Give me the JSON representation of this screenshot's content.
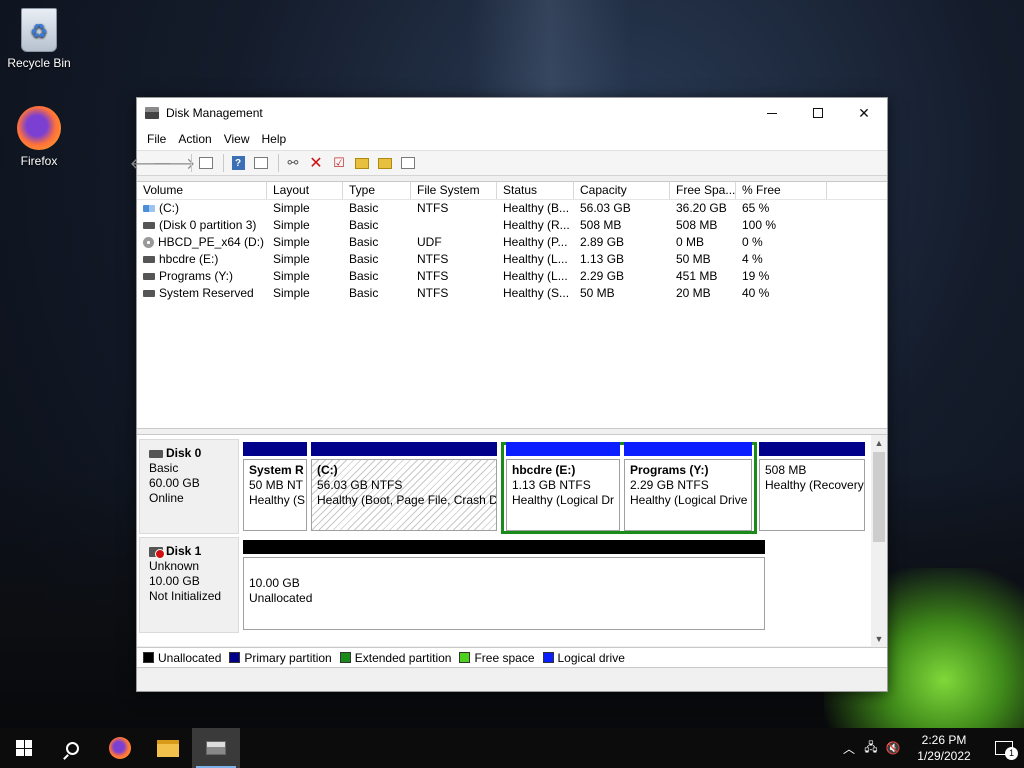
{
  "desktop": {
    "icons": [
      {
        "label": "Recycle Bin",
        "icon": "recycle-bin-icon"
      },
      {
        "label": "Firefox",
        "icon": "firefox-icon"
      }
    ]
  },
  "window": {
    "title": "Disk Management",
    "menu": [
      "File",
      "Action",
      "View",
      "Help"
    ]
  },
  "volume_list": {
    "columns": [
      "Volume",
      "Layout",
      "Type",
      "File System",
      "Status",
      "Capacity",
      "Free Spa...",
      "% Free"
    ],
    "rows": [
      {
        "volume": "(C:)",
        "layout": "Simple",
        "type": "Basic",
        "fs": "NTFS",
        "status": "Healthy (B...",
        "capacity": "56.03 GB",
        "free": "36.20 GB",
        "pct": "65 %",
        "icon": "volume-icon"
      },
      {
        "volume": "(Disk 0 partition 3)",
        "layout": "Simple",
        "type": "Basic",
        "fs": "",
        "status": "Healthy (R...",
        "capacity": "508 MB",
        "free": "508 MB",
        "pct": "100 %",
        "icon": "volume-icon"
      },
      {
        "volume": "HBCD_PE_x64 (D:)",
        "layout": "Simple",
        "type": "Basic",
        "fs": "UDF",
        "status": "Healthy (P...",
        "capacity": "2.89 GB",
        "free": "0 MB",
        "pct": "0 %",
        "icon": "cd-drive-icon"
      },
      {
        "volume": "hbcdre (E:)",
        "layout": "Simple",
        "type": "Basic",
        "fs": "NTFS",
        "status": "Healthy (L...",
        "capacity": "1.13 GB",
        "free": "50 MB",
        "pct": "4 %",
        "icon": "volume-icon"
      },
      {
        "volume": "Programs (Y:)",
        "layout": "Simple",
        "type": "Basic",
        "fs": "NTFS",
        "status": "Healthy (L...",
        "capacity": "2.29 GB",
        "free": "451 MB",
        "pct": "19 %",
        "icon": "volume-icon"
      },
      {
        "volume": "System Reserved",
        "layout": "Simple",
        "type": "Basic",
        "fs": "NTFS",
        "status": "Healthy (S...",
        "capacity": "50 MB",
        "free": "20 MB",
        "pct": "40 %",
        "icon": "volume-icon"
      }
    ]
  },
  "disks": {
    "disk0": {
      "name": "Disk 0",
      "type": "Basic",
      "size": "60.00 GB",
      "state": "Online",
      "partitions": [
        {
          "title": "System R",
          "line1": "50 MB NT",
          "line2": "Healthy (S"
        },
        {
          "title": "(C:)",
          "line1": "56.03 GB NTFS",
          "line2": "Healthy (Boot, Page File, Crash D"
        },
        {
          "title": "hbcdre  (E:)",
          "line1": "1.13 GB NTFS",
          "line2": "Healthy (Logical Dr"
        },
        {
          "title": "Programs  (Y:)",
          "line1": "2.29 GB NTFS",
          "line2": "Healthy (Logical Drive"
        },
        {
          "title": "",
          "line1": "508 MB",
          "line2": "Healthy (Recovery"
        }
      ]
    },
    "disk1": {
      "name": "Disk 1",
      "type": "Unknown",
      "size": "10.00 GB",
      "state": "Not Initialized",
      "partitions": [
        {
          "line1": "10.00 GB",
          "line2": "Unallocated"
        }
      ]
    }
  },
  "legend": [
    {
      "label": "Unallocated",
      "color": "#000000"
    },
    {
      "label": "Primary partition",
      "color": "#00008b"
    },
    {
      "label": "Extended partition",
      "color": "#1a8a1a"
    },
    {
      "label": "Free space",
      "color": "#4cd11c"
    },
    {
      "label": "Logical drive",
      "color": "#0a1eff"
    }
  ],
  "taskbar": {
    "clock_time": "2:26 PM",
    "clock_date": "1/29/2022",
    "notification_count": "1"
  }
}
